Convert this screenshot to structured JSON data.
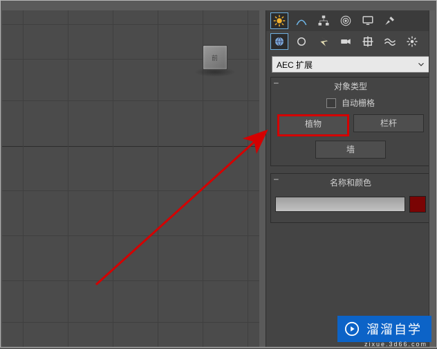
{
  "viewport": {
    "cube_label": "前"
  },
  "panel": {
    "dropdown_value": "AEC 扩展",
    "rollouts": {
      "object_type": {
        "title": "对象类型",
        "auto_grid_label": "自动栅格",
        "buttons": {
          "plant": "植物",
          "railing": "栏杆",
          "wall": "墙"
        }
      },
      "name_color": {
        "title": "名称和颜色"
      }
    }
  },
  "watermark": {
    "text": "溜溜自学",
    "url": "zixue.3d66.com"
  }
}
